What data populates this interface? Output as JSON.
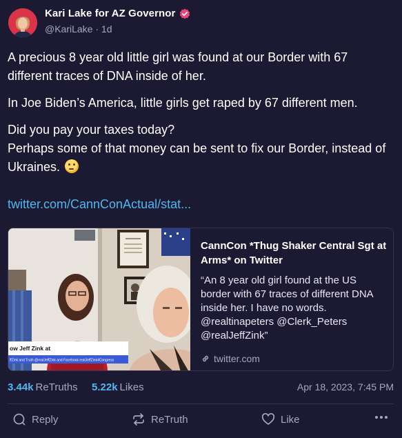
{
  "post": {
    "author": {
      "display_name": "Kari Lake for AZ Governor",
      "handle": "@KariLake",
      "separator": "·",
      "age": "1d",
      "verified": true
    },
    "paragraphs": [
      "A precious 8 year old little girl was found at our Border with 67 different traces of DNA inside of her.",
      "In Joe Biden’s America, little girls get raped by 67 different men.",
      "Did you pay your taxes today?",
      "Perhaps some of that money can be sent to fix our Border, instead of Ukraines."
    ],
    "emoji": "thinking-face",
    "link_text": "twitter.com/CannConActual/stat...",
    "card": {
      "title": "CannCon *Thug Shaker Central Sgt at Arms* on Twitter",
      "description": "“An 8 year old girl found at the US border with 67 traces of different DNA inside her. I have no words. @realtinapeters @Clerk_Peters @realJeffZink”",
      "domain": "twitter.com",
      "image_caption_line1": "ow Jeff Zink at",
      "image_caption_line2": "ffZink and Truth @realJeffZink and Facebook realJeffZink4Congress"
    },
    "stats": {
      "retruths_count": "3.44k",
      "retruths_label": "ReTruths",
      "likes_count": "5.22k",
      "likes_label": "Likes",
      "timestamp": "Apr 18, 2023, 7:45 PM"
    },
    "actions": {
      "reply": "Reply",
      "retruth": "ReTruth",
      "like": "Like"
    }
  },
  "colors": {
    "background": "#1c1932",
    "accent": "#4fb8f0",
    "muted": "#a9a6c4",
    "verified": "#e8457a"
  }
}
